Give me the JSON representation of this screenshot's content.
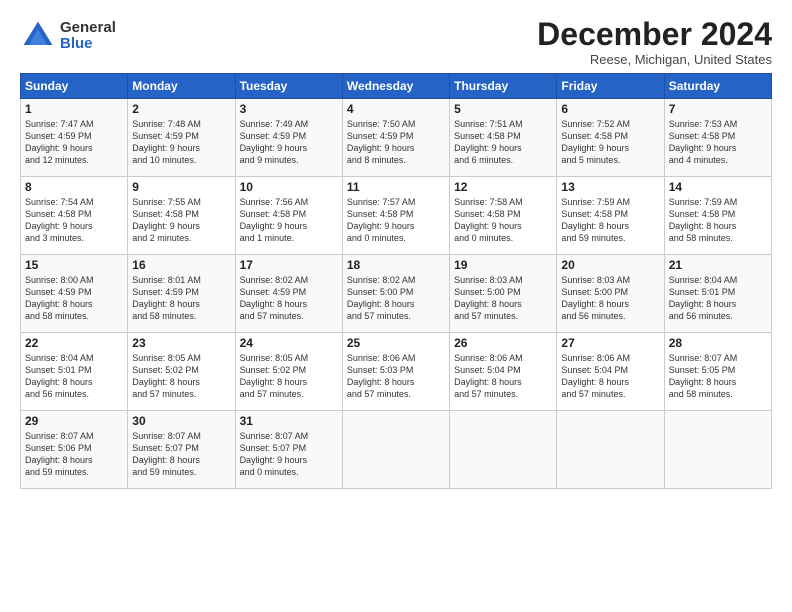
{
  "header": {
    "logo_general": "General",
    "logo_blue": "Blue",
    "title": "December 2024",
    "subtitle": "Reese, Michigan, United States"
  },
  "days_of_week": [
    "Sunday",
    "Monday",
    "Tuesday",
    "Wednesday",
    "Thursday",
    "Friday",
    "Saturday"
  ],
  "weeks": [
    [
      {
        "day": "1",
        "info": "Sunrise: 7:47 AM\nSunset: 4:59 PM\nDaylight: 9 hours\nand 12 minutes."
      },
      {
        "day": "2",
        "info": "Sunrise: 7:48 AM\nSunset: 4:59 PM\nDaylight: 9 hours\nand 10 minutes."
      },
      {
        "day": "3",
        "info": "Sunrise: 7:49 AM\nSunset: 4:59 PM\nDaylight: 9 hours\nand 9 minutes."
      },
      {
        "day": "4",
        "info": "Sunrise: 7:50 AM\nSunset: 4:59 PM\nDaylight: 9 hours\nand 8 minutes."
      },
      {
        "day": "5",
        "info": "Sunrise: 7:51 AM\nSunset: 4:58 PM\nDaylight: 9 hours\nand 6 minutes."
      },
      {
        "day": "6",
        "info": "Sunrise: 7:52 AM\nSunset: 4:58 PM\nDaylight: 9 hours\nand 5 minutes."
      },
      {
        "day": "7",
        "info": "Sunrise: 7:53 AM\nSunset: 4:58 PM\nDaylight: 9 hours\nand 4 minutes."
      }
    ],
    [
      {
        "day": "8",
        "info": "Sunrise: 7:54 AM\nSunset: 4:58 PM\nDaylight: 9 hours\nand 3 minutes."
      },
      {
        "day": "9",
        "info": "Sunrise: 7:55 AM\nSunset: 4:58 PM\nDaylight: 9 hours\nand 2 minutes."
      },
      {
        "day": "10",
        "info": "Sunrise: 7:56 AM\nSunset: 4:58 PM\nDaylight: 9 hours\nand 1 minute."
      },
      {
        "day": "11",
        "info": "Sunrise: 7:57 AM\nSunset: 4:58 PM\nDaylight: 9 hours\nand 0 minutes."
      },
      {
        "day": "12",
        "info": "Sunrise: 7:58 AM\nSunset: 4:58 PM\nDaylight: 9 hours\nand 0 minutes."
      },
      {
        "day": "13",
        "info": "Sunrise: 7:59 AM\nSunset: 4:58 PM\nDaylight: 8 hours\nand 59 minutes."
      },
      {
        "day": "14",
        "info": "Sunrise: 7:59 AM\nSunset: 4:58 PM\nDaylight: 8 hours\nand 58 minutes."
      }
    ],
    [
      {
        "day": "15",
        "info": "Sunrise: 8:00 AM\nSunset: 4:59 PM\nDaylight: 8 hours\nand 58 minutes."
      },
      {
        "day": "16",
        "info": "Sunrise: 8:01 AM\nSunset: 4:59 PM\nDaylight: 8 hours\nand 58 minutes."
      },
      {
        "day": "17",
        "info": "Sunrise: 8:02 AM\nSunset: 4:59 PM\nDaylight: 8 hours\nand 57 minutes."
      },
      {
        "day": "18",
        "info": "Sunrise: 8:02 AM\nSunset: 5:00 PM\nDaylight: 8 hours\nand 57 minutes."
      },
      {
        "day": "19",
        "info": "Sunrise: 8:03 AM\nSunset: 5:00 PM\nDaylight: 8 hours\nand 57 minutes."
      },
      {
        "day": "20",
        "info": "Sunrise: 8:03 AM\nSunset: 5:00 PM\nDaylight: 8 hours\nand 56 minutes."
      },
      {
        "day": "21",
        "info": "Sunrise: 8:04 AM\nSunset: 5:01 PM\nDaylight: 8 hours\nand 56 minutes."
      }
    ],
    [
      {
        "day": "22",
        "info": "Sunrise: 8:04 AM\nSunset: 5:01 PM\nDaylight: 8 hours\nand 56 minutes."
      },
      {
        "day": "23",
        "info": "Sunrise: 8:05 AM\nSunset: 5:02 PM\nDaylight: 8 hours\nand 57 minutes."
      },
      {
        "day": "24",
        "info": "Sunrise: 8:05 AM\nSunset: 5:02 PM\nDaylight: 8 hours\nand 57 minutes."
      },
      {
        "day": "25",
        "info": "Sunrise: 8:06 AM\nSunset: 5:03 PM\nDaylight: 8 hours\nand 57 minutes."
      },
      {
        "day": "26",
        "info": "Sunrise: 8:06 AM\nSunset: 5:04 PM\nDaylight: 8 hours\nand 57 minutes."
      },
      {
        "day": "27",
        "info": "Sunrise: 8:06 AM\nSunset: 5:04 PM\nDaylight: 8 hours\nand 57 minutes."
      },
      {
        "day": "28",
        "info": "Sunrise: 8:07 AM\nSunset: 5:05 PM\nDaylight: 8 hours\nand 58 minutes."
      }
    ],
    [
      {
        "day": "29",
        "info": "Sunrise: 8:07 AM\nSunset: 5:06 PM\nDaylight: 8 hours\nand 59 minutes."
      },
      {
        "day": "30",
        "info": "Sunrise: 8:07 AM\nSunset: 5:07 PM\nDaylight: 8 hours\nand 59 minutes."
      },
      {
        "day": "31",
        "info": "Sunrise: 8:07 AM\nSunset: 5:07 PM\nDaylight: 9 hours\nand 0 minutes."
      },
      {
        "day": "",
        "info": ""
      },
      {
        "day": "",
        "info": ""
      },
      {
        "day": "",
        "info": ""
      },
      {
        "day": "",
        "info": ""
      }
    ]
  ]
}
